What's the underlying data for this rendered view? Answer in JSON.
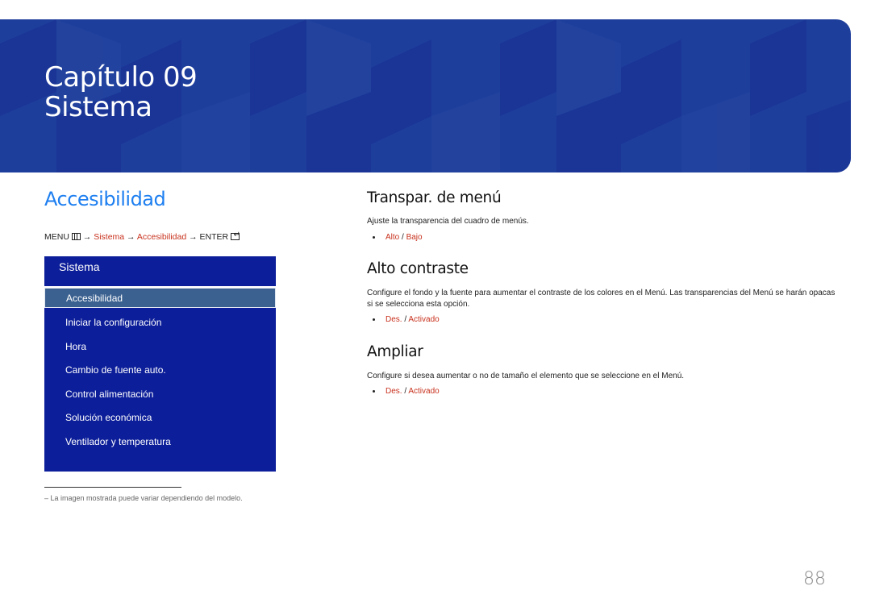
{
  "banner": {
    "chapter_line": "Capítulo 09",
    "chapter_title": "Sistema",
    "color": "#1e3e9c"
  },
  "section": {
    "title": "Accesibilidad",
    "breadcrumb": {
      "menu": "MENU",
      "arrow": "→",
      "path": [
        "Sistema",
        "Accesibilidad"
      ],
      "enter": "ENTER"
    }
  },
  "menu_panel": {
    "header": "Sistema",
    "items": [
      {
        "label": "Accesibilidad",
        "selected": true
      },
      {
        "label": "Iniciar la configuración"
      },
      {
        "label": "Hora"
      },
      {
        "label": "Cambio de fuente auto."
      },
      {
        "label": "Control alimentación"
      },
      {
        "label": "Solución económica"
      },
      {
        "label": "Ventilador y temperatura"
      }
    ]
  },
  "footnote": "–  La imagen mostrada puede variar dependiendo del modelo.",
  "settings": [
    {
      "title": "Transpar. de menú",
      "description": "Ajuste la transparencia del cuadro de menús.",
      "options": [
        "Alto",
        "Bajo"
      ]
    },
    {
      "title": "Alto contraste",
      "description": "Configure el fondo y la fuente para aumentar el contraste de los colores en el Menú. Las transparencias del Menú se harán opacas si se selecciona esta opción.",
      "options": [
        "Des.",
        "Activado"
      ]
    },
    {
      "title": "Ampliar",
      "description": "Configure si desea aumentar o no de tamaño el elemento que se seleccione en el Menú.",
      "options": [
        "Des.",
        "Activado"
      ]
    }
  ],
  "separator": "/",
  "page_number": "88",
  "colors": {
    "accent_blue": "#1e7ff0",
    "highlight_red": "#c8321e",
    "menu_bg": "#0c1e99",
    "menu_selected": "#3b6190"
  }
}
